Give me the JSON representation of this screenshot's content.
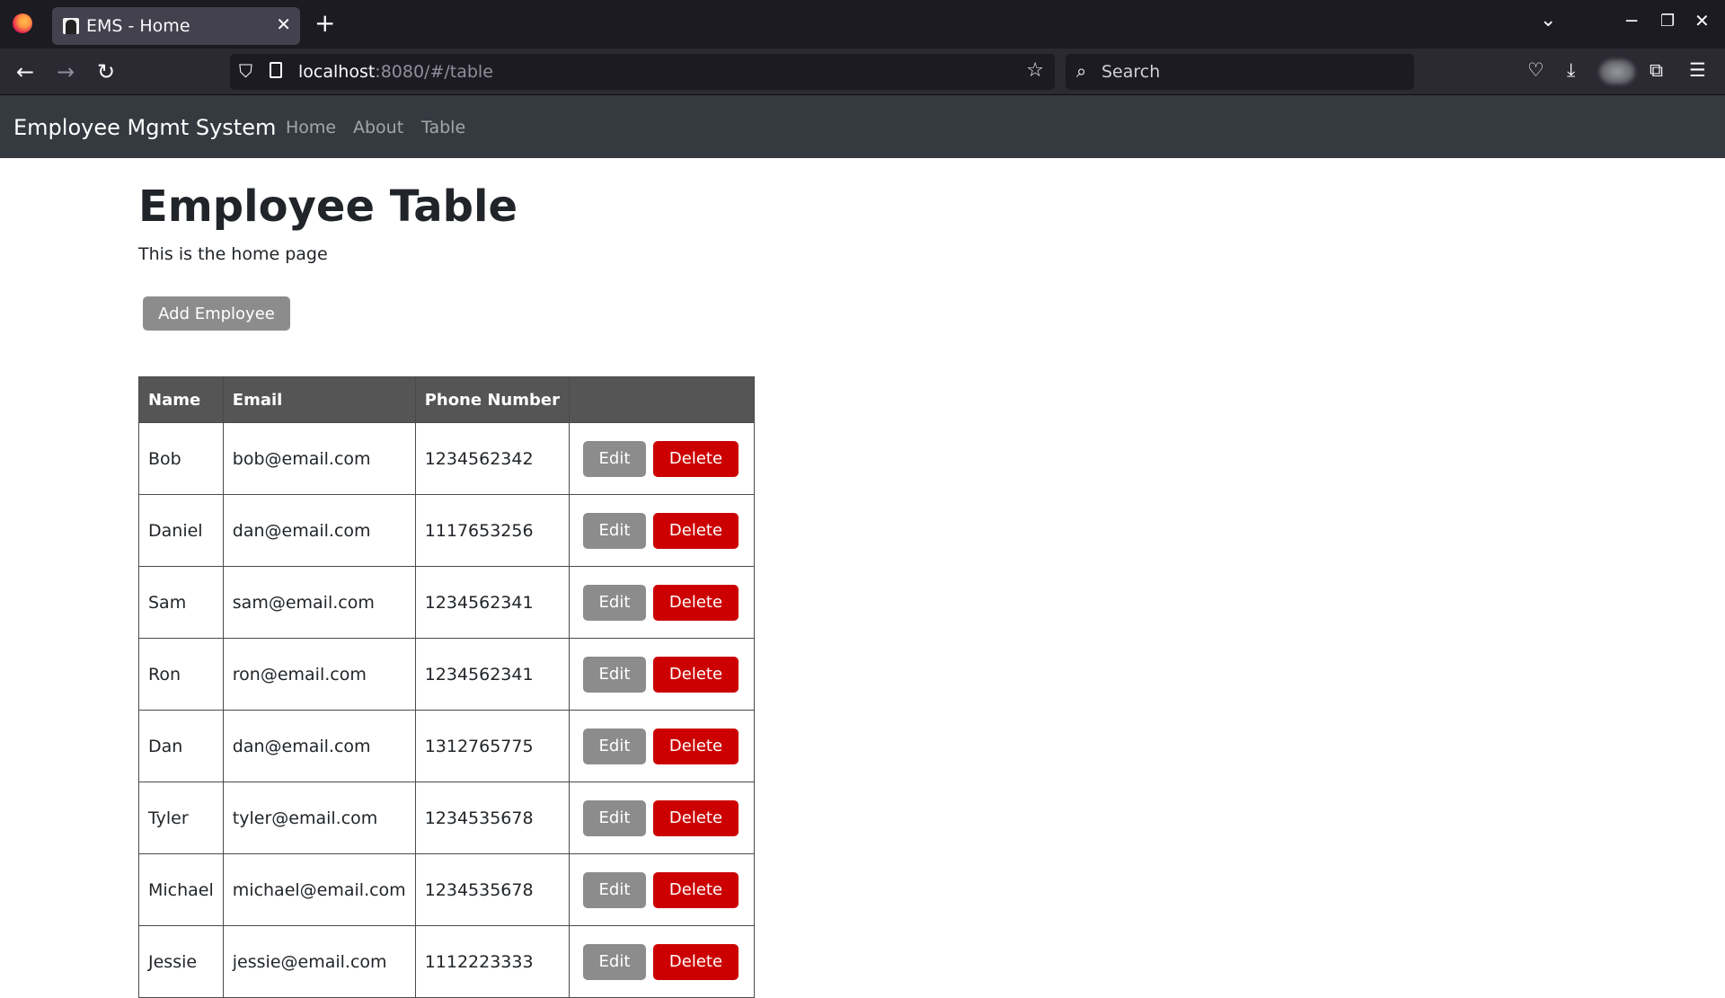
{
  "browser": {
    "tab_title": "EMS - Home",
    "url_host": "localhost",
    "url_rest": ":8080/#/table",
    "search_placeholder": "Search"
  },
  "app": {
    "brand": "Employee Mgmt System",
    "nav": [
      "Home",
      "About",
      "Table"
    ]
  },
  "page": {
    "title": "Employee Table",
    "subtitle": "This is the home page",
    "add_button": "Add Employee"
  },
  "table": {
    "headers": [
      "Name",
      "Email",
      "Phone Number",
      ""
    ],
    "edit_label": "Edit",
    "delete_label": "Delete",
    "rows": [
      {
        "name": "Bob",
        "email": "bob@email.com",
        "phone": "1234562342"
      },
      {
        "name": "Daniel",
        "email": "dan@email.com",
        "phone": "1117653256"
      },
      {
        "name": "Sam",
        "email": "sam@email.com",
        "phone": "1234562341"
      },
      {
        "name": "Ron",
        "email": "ron@email.com",
        "phone": "1234562341"
      },
      {
        "name": "Dan",
        "email": "dan@email.com",
        "phone": "1312765775"
      },
      {
        "name": "Tyler",
        "email": "tyler@email.com",
        "phone": "1234535678"
      },
      {
        "name": "Michael",
        "email": "michael@email.com",
        "phone": "1234535678"
      },
      {
        "name": "Jessie",
        "email": "jessie@email.com",
        "phone": "1112223333"
      }
    ]
  },
  "colors": {
    "app_nav_bg": "#343a40",
    "header_bg": "#555555",
    "edit_bg": "#8c8c8c",
    "delete_bg": "#cc0000"
  }
}
